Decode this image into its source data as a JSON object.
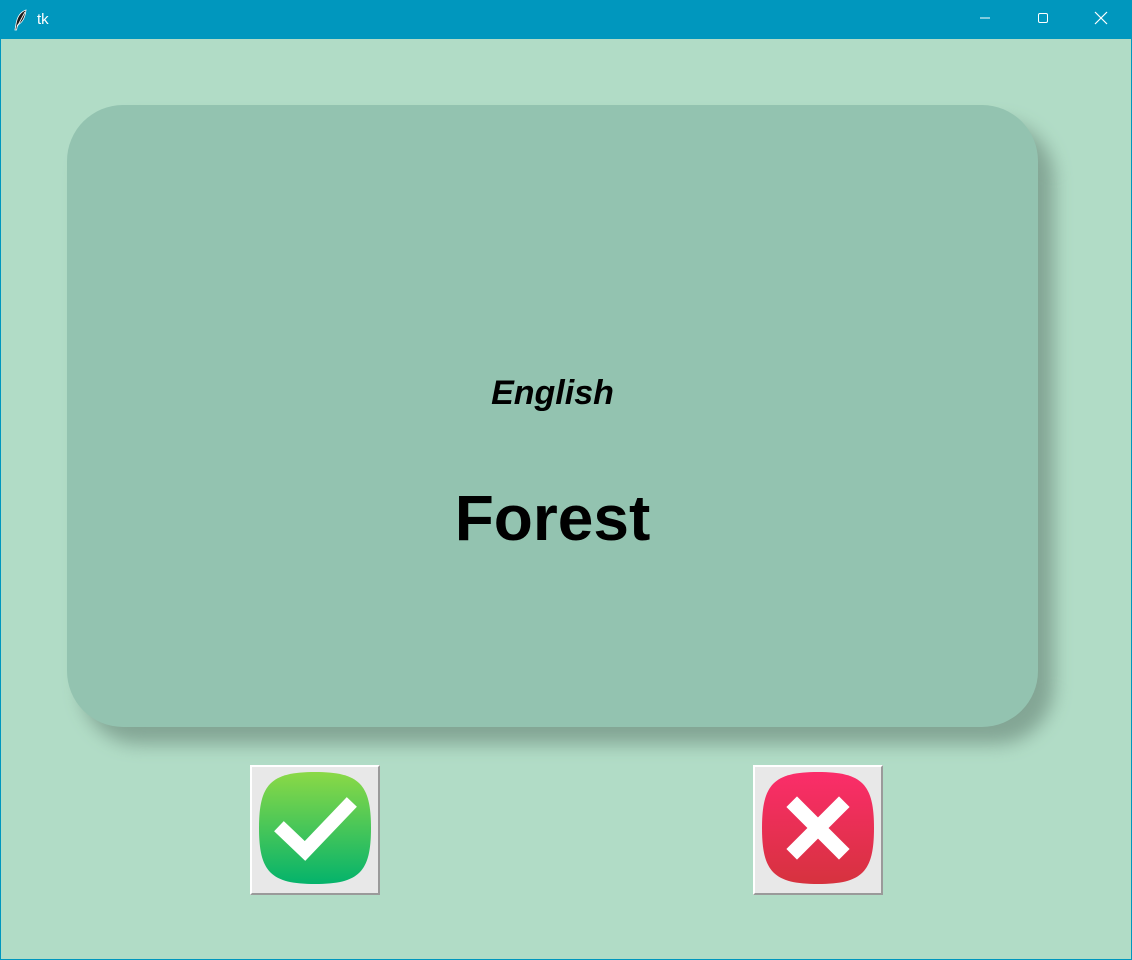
{
  "window": {
    "title": "tk",
    "app_icon": "feather-icon",
    "controls": [
      "minimize-icon",
      "maximize-icon",
      "close-icon"
    ]
  },
  "card": {
    "language": "English",
    "word": "Forest"
  },
  "buttons": {
    "right_icon": "check-icon",
    "wrong_icon": "x-icon"
  },
  "colors": {
    "titlebar": "#0097be",
    "background": "#b1dcc6",
    "card": "#93c3b0",
    "right_gradient": [
      "#8bd946",
      "#04b36b"
    ],
    "wrong_gradient": [
      "#fb2d6a",
      "#d6323e"
    ]
  }
}
